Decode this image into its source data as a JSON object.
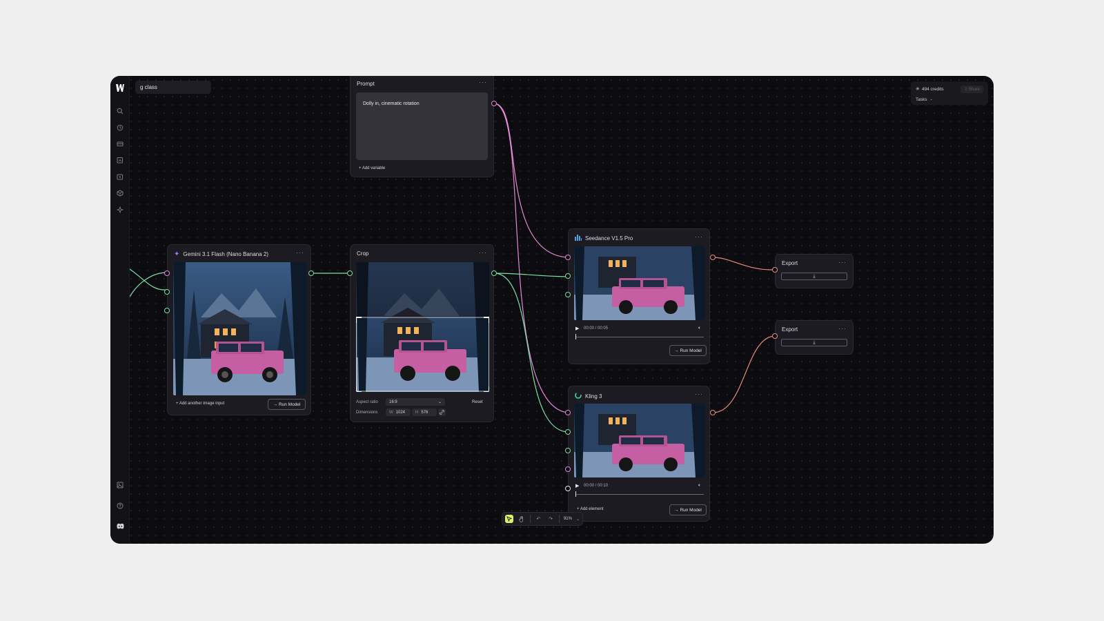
{
  "project": {
    "name": "g class"
  },
  "account": {
    "credits": "494 credits",
    "share_label": "Share",
    "tasks_label": "Tasks"
  },
  "nodes": {
    "prompt": {
      "title": "Prompt",
      "text": "Dolly in, cinematic rotation",
      "add_variable": "Add variable"
    },
    "gemini": {
      "title": "Gemini 3.1 Flash (Nano Banana 2)",
      "add_input": "Add another image input",
      "run": "Run Model"
    },
    "crop": {
      "title": "Crop",
      "aspect_label": "Aspect ratio",
      "aspect_value": "16:9",
      "reset": "Reset",
      "dimensions_label": "Dimensions",
      "w_label": "W",
      "w_value": "1024",
      "h_label": "H",
      "h_value": "576"
    },
    "seedance": {
      "title": "Seedance V1.5 Pro",
      "time": "00:00 / 00:05",
      "run": "Run Model"
    },
    "kling": {
      "title": "Kling 3",
      "time": "00:00 / 00:10",
      "add_element": "Add element",
      "run": "Run Model"
    },
    "export1": {
      "title": "Export"
    },
    "export2": {
      "title": "Export"
    }
  },
  "toolbar": {
    "zoom": "91%"
  },
  "colors": {
    "image_edge": "#e58ad6",
    "video_edge": "#7be3a3",
    "output_edge": "#ea8c7c",
    "accent": "#d8f26b"
  }
}
